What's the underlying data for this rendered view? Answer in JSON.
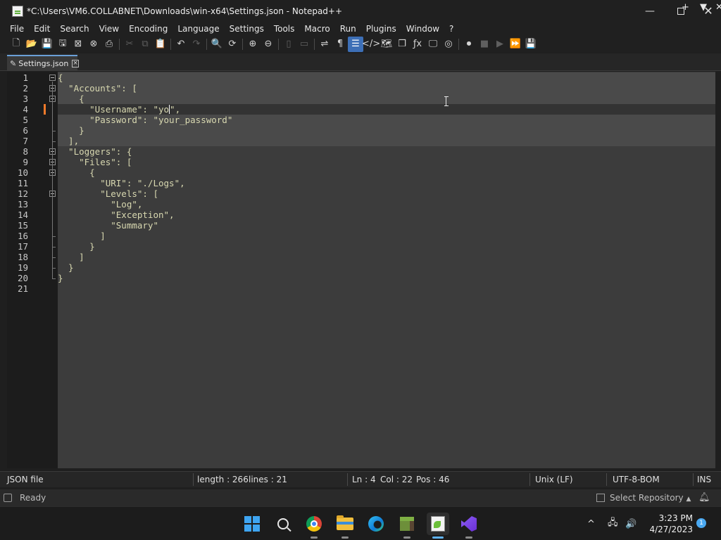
{
  "window": {
    "title": "*C:\\Users\\VM6.COLLABNET\\Downloads\\win-x64\\Settings.json - Notepad++",
    "minimize": "—",
    "close": "✕"
  },
  "menu": {
    "items": [
      "File",
      "Edit",
      "Search",
      "View",
      "Encoding",
      "Language",
      "Settings",
      "Tools",
      "Macro",
      "Run",
      "Plugins",
      "Window",
      "?"
    ],
    "right": [
      "+",
      "▼",
      "✕"
    ]
  },
  "toolbar": {
    "icons": [
      {
        "name": "new-file-icon",
        "glyph": "🗋",
        "dim": false
      },
      {
        "name": "open-file-icon",
        "glyph": "📂",
        "dim": false
      },
      {
        "name": "save-icon",
        "glyph": "💾",
        "dim": false
      },
      {
        "name": "save-all-icon",
        "glyph": "🖫",
        "dim": false
      },
      {
        "name": "close-file-icon",
        "glyph": "⊠",
        "dim": false
      },
      {
        "name": "close-all-icon",
        "glyph": "⊗",
        "dim": false
      },
      {
        "name": "print-icon",
        "glyph": "⎙",
        "dim": false
      },
      {
        "sep": true
      },
      {
        "name": "cut-icon",
        "glyph": "✂",
        "dim": true
      },
      {
        "name": "copy-icon",
        "glyph": "⧉",
        "dim": true
      },
      {
        "name": "paste-icon",
        "glyph": "📋",
        "dim": true
      },
      {
        "sep": true
      },
      {
        "name": "undo-icon",
        "glyph": "↶",
        "dim": false
      },
      {
        "name": "redo-icon",
        "glyph": "↷",
        "dim": true
      },
      {
        "sep": true
      },
      {
        "name": "find-icon",
        "glyph": "🔍",
        "dim": false
      },
      {
        "name": "replace-icon",
        "glyph": "⟳",
        "dim": false
      },
      {
        "sep": true
      },
      {
        "name": "zoom-in-icon",
        "glyph": "⊕",
        "dim": false
      },
      {
        "name": "zoom-out-icon",
        "glyph": "⊖",
        "dim": false
      },
      {
        "sep": true
      },
      {
        "name": "sync-vertical-icon",
        "glyph": "▯",
        "dim": true
      },
      {
        "name": "sync-horizontal-icon",
        "glyph": "▭",
        "dim": true
      },
      {
        "sep": true
      },
      {
        "name": "word-wrap-icon",
        "glyph": "⇌",
        "dim": false
      },
      {
        "name": "show-all-chars-icon",
        "glyph": "¶",
        "dim": false
      },
      {
        "name": "indent-guide-icon",
        "glyph": "☰",
        "dim": false,
        "active": true
      },
      {
        "name": "xml-tag-icon",
        "glyph": "</>",
        "dim": false
      },
      {
        "name": "document-map-icon",
        "glyph": "🗺",
        "dim": false
      },
      {
        "name": "document-list-icon",
        "glyph": "❐",
        "dim": false
      },
      {
        "name": "function-list-icon",
        "glyph": "ƒx",
        "dim": false
      },
      {
        "name": "folder-workspace-icon",
        "glyph": "🖵",
        "dim": false
      },
      {
        "name": "monitoring-icon",
        "glyph": "◎",
        "dim": false
      },
      {
        "sep": true
      },
      {
        "name": "record-macro-icon",
        "glyph": "⏺",
        "dim": false
      },
      {
        "name": "stop-macro-icon",
        "glyph": "■",
        "dim": true
      },
      {
        "name": "play-macro-icon",
        "glyph": "▶",
        "dim": true
      },
      {
        "name": "run-macro-multiple-icon",
        "glyph": "⏩",
        "dim": false
      },
      {
        "name": "save-macro-icon",
        "glyph": "💾",
        "dim": true
      }
    ]
  },
  "tab": {
    "label": "Settings.json"
  },
  "editor": {
    "lines": [
      {
        "n": "1",
        "text": "{"
      },
      {
        "n": "2",
        "text": "  \"Accounts\": ["
      },
      {
        "n": "3",
        "text": "    {"
      },
      {
        "n": "4",
        "pre": "      \"Username\": \"yo",
        "post": "\","
      },
      {
        "n": "5",
        "text": "      \"Password\": \"your_password\""
      },
      {
        "n": "6",
        "text": "    }"
      },
      {
        "n": "7",
        "text": "  ],"
      },
      {
        "n": "8",
        "text": "  \"Loggers\": {"
      },
      {
        "n": "9",
        "text": "    \"Files\": ["
      },
      {
        "n": "10",
        "text": "      {"
      },
      {
        "n": "11",
        "text": "        \"URI\": \"./Logs\","
      },
      {
        "n": "12",
        "text": "        \"Levels\": ["
      },
      {
        "n": "13",
        "text": "          \"Log\","
      },
      {
        "n": "14",
        "text": "          \"Exception\","
      },
      {
        "n": "15",
        "text": "          \"Summary\""
      },
      {
        "n": "16",
        "text": "        ]"
      },
      {
        "n": "17",
        "text": "      }"
      },
      {
        "n": "18",
        "text": "    ]"
      },
      {
        "n": "19",
        "text": "  }"
      },
      {
        "n": "20",
        "text": "}"
      },
      {
        "n": "21",
        "text": ""
      }
    ]
  },
  "status": {
    "file_type": "JSON file",
    "length": "length : 266",
    "lines": "lines : 21",
    "ln": "Ln : 4",
    "col": "Col : 22",
    "pos": "Pos : 46",
    "eol": "Unix (LF)",
    "encoding": "UTF-8-BOM",
    "mode": "INS"
  },
  "vs_status": {
    "ready": "Ready",
    "repo": "Select Repository",
    "repo_arrow": "▲"
  },
  "taskbar": {
    "time": "3:23 PM",
    "date": "4/27/2023",
    "notifications": "1",
    "tray_chevron": "^",
    "tray_network": "🖧",
    "tray_volume": "🔊"
  }
}
